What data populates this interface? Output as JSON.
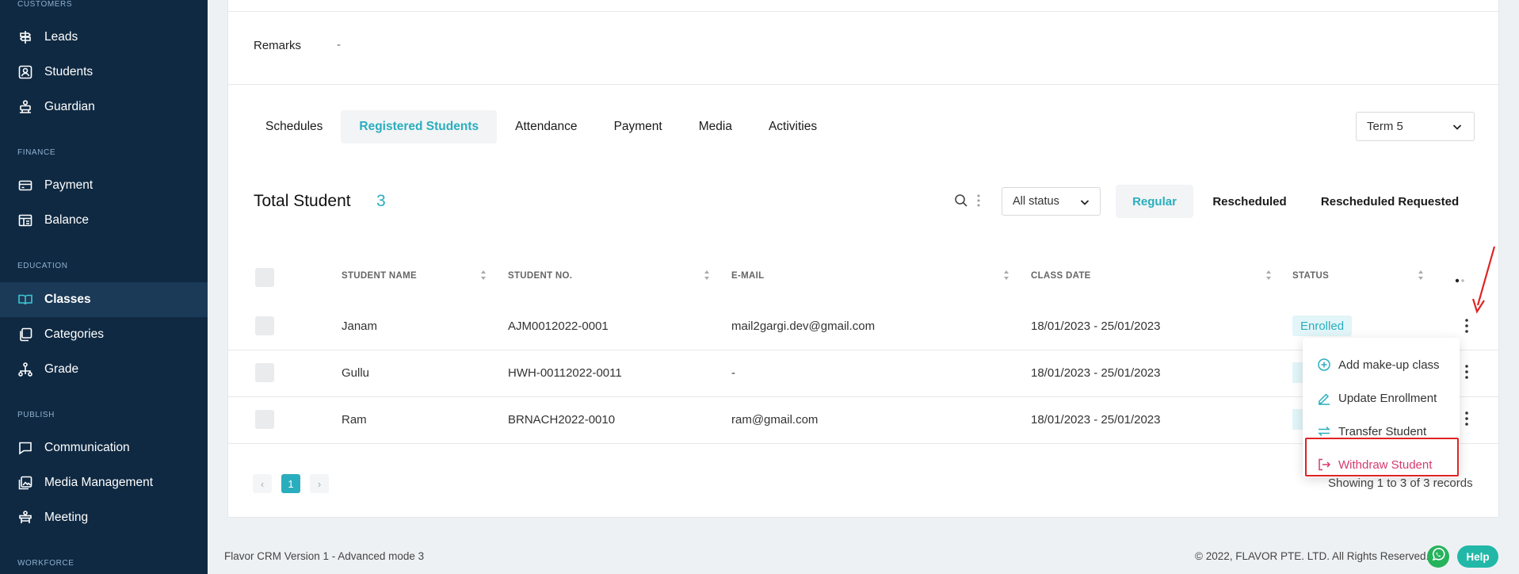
{
  "sidebar": {
    "sections": {
      "customers": "CUSTOMERS",
      "finance": "FINANCE",
      "education": "EDUCATION",
      "publish": "PUBLISH",
      "workforce": "WORKFORCE"
    },
    "items": {
      "leads": "Leads",
      "students": "Students",
      "guardian": "Guardian",
      "payment": "Payment",
      "balance": "Balance",
      "classes": "Classes",
      "categories": "Categories",
      "grade": "Grade",
      "communication": "Communication",
      "media_management": "Media Management",
      "meeting": "Meeting"
    },
    "active_item": "Classes"
  },
  "remarks": {
    "label": "Remarks",
    "value": "-"
  },
  "tabs": {
    "schedules": "Schedules",
    "registered_students": "Registered Students",
    "attendance": "Attendance",
    "payment": "Payment",
    "media": "Media",
    "activities": "Activities",
    "active": "Registered Students"
  },
  "term_select": {
    "value": "Term 5"
  },
  "summary": {
    "title": "Total Student",
    "count": "3"
  },
  "status_filter": {
    "value": "All status"
  },
  "filters": {
    "regular": "Regular",
    "rescheduled": "Rescheduled",
    "rescheduled_requested": "Rescheduled Requested",
    "active": "Regular"
  },
  "table": {
    "headers": {
      "student_name": "STUDENT NAME",
      "student_no": "STUDENT NO.",
      "email": "E-MAIL",
      "class_date": "CLASS DATE",
      "status": "STATUS"
    },
    "rows": [
      {
        "name": "Janam",
        "student_no": "AJM0012022-0001",
        "email": "mail2gargi.dev@gmail.com",
        "class_date": "18/01/2023 - 25/01/2023",
        "status": "Enrolled"
      },
      {
        "name": "Gullu",
        "student_no": "HWH-00112022-0011",
        "email": "-",
        "class_date": "18/01/2023 - 25/01/2023",
        "status": "Enrolled"
      },
      {
        "name": "Ram",
        "student_no": "BRNACH2022-0010",
        "email": "ram@gmail.com",
        "class_date": "18/01/2023 - 25/01/2023",
        "status": "Enrolled"
      }
    ]
  },
  "pagination": {
    "prev": "‹",
    "current": "1",
    "next": "›",
    "records": "Showing 1 to 3 of 3 records"
  },
  "row_menu": {
    "add_makeup": "Add make-up class",
    "update_enrollment": "Update Enrollment",
    "transfer_student": "Transfer Student",
    "withdraw_student": "Withdraw Student"
  },
  "footer": {
    "version": "Flavor CRM Version 1 - Advanced mode 3",
    "copyright": "© 2022, FLAVOR PTE. LTD. All Rights Reserved.",
    "help": "Help"
  },
  "colors": {
    "sidebar_bg": "#0f2942",
    "accent": "#2aaebd",
    "danger": "#d43b6e",
    "highlight": "#e02323",
    "whatsapp": "#25b35c",
    "help_btn": "#22b8a8"
  }
}
